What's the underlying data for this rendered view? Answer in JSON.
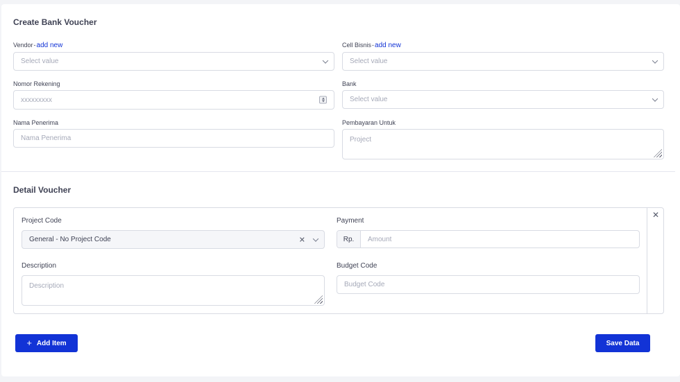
{
  "form": {
    "title": "Create Bank Voucher",
    "vendor": {
      "label": "Vendor",
      "separator": "-",
      "link": "add new",
      "placeholder": "Select value"
    },
    "cell_bisnis": {
      "label": "Cell Bisnis",
      "separator": "-",
      "link": "add new",
      "placeholder": "Select value"
    },
    "nomor_rekening": {
      "label": "Nomor Rekening",
      "placeholder": "xxxxxxxxx"
    },
    "bank": {
      "label": "Bank",
      "placeholder": "Select value"
    },
    "nama_penerima": {
      "label": "Nama Penerima",
      "placeholder": "Nama Penerima"
    },
    "pembayaran_untuk": {
      "label": "Pembayaran Untuk",
      "placeholder": "Project"
    }
  },
  "detail": {
    "title": "Detail Voucher",
    "close_icon": "close-icon",
    "project_code": {
      "label": "Project Code",
      "value": "General - No Project Code"
    },
    "payment": {
      "label": "Payment",
      "prefix": "Rp.",
      "placeholder": "Amount"
    },
    "description": {
      "label": "Description",
      "placeholder": "Description"
    },
    "budget_code": {
      "label": "Budget Code",
      "placeholder": "Budget Code"
    }
  },
  "actions": {
    "add_item": "Add Item",
    "add_icon": "plus-icon",
    "save": "Save Data"
  },
  "colors": {
    "primary": "#1233d6",
    "border": "#d8dbe3",
    "text": "#3f4254",
    "placeholder": "#a5a9b8"
  }
}
